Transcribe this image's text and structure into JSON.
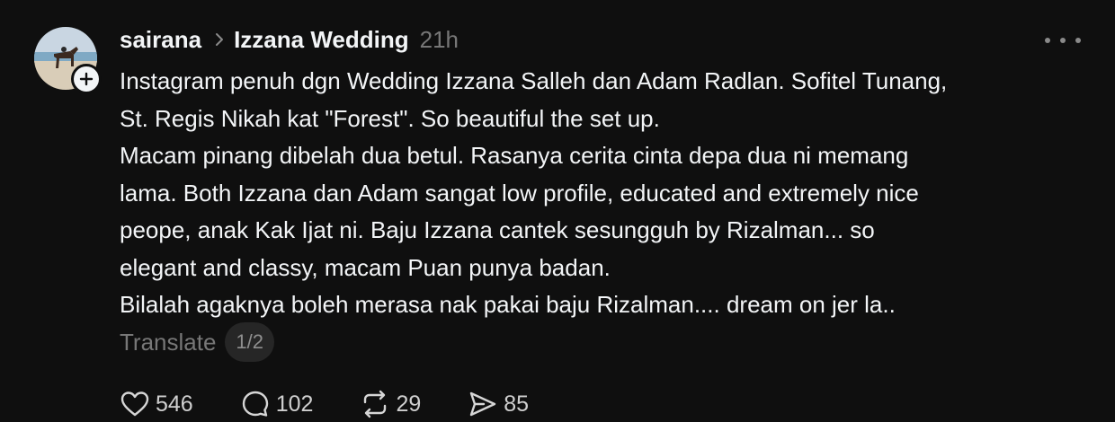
{
  "post": {
    "avatar_icon": "avatar-horse-beach",
    "username": "sairana",
    "separator_icon": "chevron-right-icon",
    "topic": "Izzana Wedding",
    "time": "21h",
    "more_icon": "more-horizontal-icon",
    "lines": [
      "Instagram penuh dgn Wedding Izzana Salleh dan Adam Radlan. Sofitel Tunang,",
      "St. Regis Nikah kat \"Forest\". So beautiful the set up.",
      "Macam pinang dibelah dua betul. Rasanya cerita cinta depa dua ni memang",
      "lama. Both Izzana dan Adam sangat low profile, educated and extremely nice",
      "peope, anak Kak Ijat ni. Baju Izzana cantek sesungguh by Rizalman... so",
      "elegant and classy, macam Puan punya badan.",
      "Bilalah agaknya boleh merasa nak pakai baju Rizalman.... dream on jer la.."
    ],
    "translate_label": "Translate",
    "page_indicator": "1/2"
  },
  "actions": {
    "likes": "546",
    "replies": "102",
    "reposts": "29",
    "shares": "85"
  },
  "colors": {
    "background": "#0f0f0f",
    "text": "#f3f5f7",
    "muted": "#777777"
  }
}
